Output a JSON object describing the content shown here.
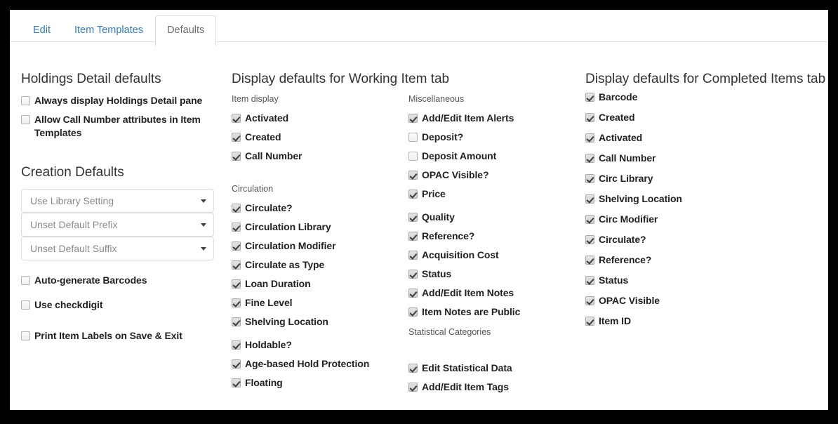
{
  "tabs": [
    {
      "label": "Edit",
      "active": false
    },
    {
      "label": "Item Templates",
      "active": false
    },
    {
      "label": "Defaults",
      "active": true
    }
  ],
  "column1": {
    "title": "Holdings Detail defaults",
    "holdings_checkboxes": [
      {
        "label": "Always display Holdings Detail pane",
        "checked": false
      },
      {
        "label": "Allow Call Number attributes in Item Templates",
        "checked": false
      }
    ],
    "creation_title": "Creation Defaults",
    "selects": [
      {
        "value": "Use Library Setting"
      },
      {
        "value": "Unset Default Prefix"
      },
      {
        "value": "Unset Default Suffix"
      }
    ],
    "barcode_checkboxes": [
      {
        "label": "Auto-generate Barcodes",
        "checked": false
      },
      {
        "label": "Use checkdigit",
        "checked": false
      }
    ],
    "print_checkbox": {
      "label": "Print Item Labels on Save & Exit",
      "checked": false
    }
  },
  "column2": {
    "title": "Display defaults for Working Item tab",
    "groups": [
      {
        "label": "Item display",
        "items": [
          {
            "label": "Activated",
            "checked": true
          },
          {
            "label": "Created",
            "checked": true
          },
          {
            "label": "Call Number",
            "checked": true
          }
        ]
      },
      {
        "label": "Circulation",
        "items": [
          {
            "label": "Circulate?",
            "checked": true
          },
          {
            "label": "Circulation Library",
            "checked": true
          },
          {
            "label": "Circulation Modifier",
            "checked": true
          },
          {
            "label": "Circulate as Type",
            "checked": true
          },
          {
            "label": "Loan Duration",
            "checked": true
          },
          {
            "label": "Fine Level",
            "checked": true
          },
          {
            "label": "Shelving Location",
            "checked": true
          }
        ]
      },
      {
        "label": "",
        "items": [
          {
            "label": "Holdable?",
            "checked": true
          },
          {
            "label": "Age-based Hold Protection",
            "checked": true
          },
          {
            "label": "Floating",
            "checked": true
          }
        ]
      }
    ],
    "misc_groups": [
      {
        "label": "Miscellaneous",
        "items": [
          {
            "label": "Add/Edit Item Alerts",
            "checked": true
          },
          {
            "label": "Deposit?",
            "checked": false
          },
          {
            "label": "Deposit Amount",
            "checked": false
          },
          {
            "label": "OPAC Visible?",
            "checked": true
          },
          {
            "label": "Price",
            "checked": true
          }
        ]
      },
      {
        "label": "",
        "items": [
          {
            "label": "Quality",
            "checked": true
          },
          {
            "label": "Reference?",
            "checked": true
          },
          {
            "label": "Acquisition Cost",
            "checked": true
          },
          {
            "label": "Status",
            "checked": true
          },
          {
            "label": "Add/Edit Item Notes",
            "checked": true
          },
          {
            "label": "Item Notes are Public",
            "checked": true
          }
        ]
      },
      {
        "label": "Statistical Categories",
        "items": [
          {
            "label": "Edit Statistical Data",
            "checked": true
          },
          {
            "label": "Add/Edit Item Tags",
            "checked": true
          }
        ]
      }
    ]
  },
  "column3": {
    "title": "Display defaults for Completed Items tab",
    "items": [
      {
        "label": "Barcode",
        "checked": true
      },
      {
        "label": "Created",
        "checked": true
      },
      {
        "label": "Activated",
        "checked": true
      },
      {
        "label": "Call Number",
        "checked": true
      },
      {
        "label": "Circ Library",
        "checked": true
      },
      {
        "label": "Shelving Location",
        "checked": true
      },
      {
        "label": "Circ Modifier",
        "checked": true
      },
      {
        "label": "Circulate?",
        "checked": true
      },
      {
        "label": "Reference?",
        "checked": true
      },
      {
        "label": "Status",
        "checked": true
      },
      {
        "label": "OPAC Visible",
        "checked": true
      },
      {
        "label": "Item ID",
        "checked": true
      }
    ]
  },
  "colors": {
    "link": "#337ab7",
    "active_tab_text": "#6d6d6d",
    "heading": "#333333",
    "label": "#555555",
    "frame": "#000000"
  }
}
